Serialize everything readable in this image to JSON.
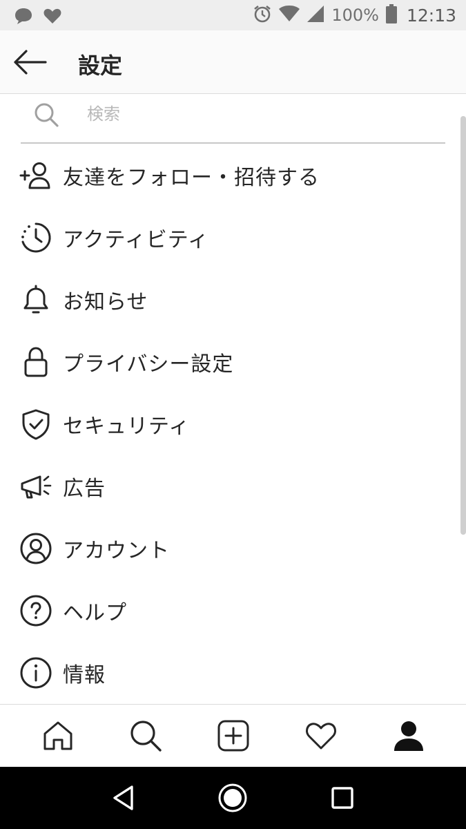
{
  "status_bar": {
    "battery": "100%",
    "time": "12:13",
    "icons": [
      "chat-bubble-icon",
      "heart-icon",
      "alarm-icon",
      "wifi-icon",
      "signal-icon",
      "battery-icon"
    ]
  },
  "header": {
    "title": "設定",
    "back_icon": "back-arrow-icon"
  },
  "search": {
    "placeholder": "検索",
    "value": ""
  },
  "menu": {
    "items": [
      {
        "label": "友達をフォロー・招待する",
        "icon": "add-person-icon"
      },
      {
        "label": "アクティビティ",
        "icon": "activity-clock-icon"
      },
      {
        "label": "お知らせ",
        "icon": "bell-icon"
      },
      {
        "label": "プライバシー設定",
        "icon": "lock-icon"
      },
      {
        "label": "セキュリティ",
        "icon": "shield-check-icon"
      },
      {
        "label": "広告",
        "icon": "megaphone-icon"
      },
      {
        "label": "アカウント",
        "icon": "account-icon"
      },
      {
        "label": "ヘルプ",
        "icon": "help-icon"
      },
      {
        "label": "情報",
        "icon": "info-icon"
      }
    ]
  },
  "bottom_nav": [
    "home-icon",
    "search-icon",
    "add-post-icon",
    "activity-heart-icon",
    "profile-icon"
  ],
  "system_nav": [
    "back-triangle-icon",
    "home-circle-icon",
    "recents-square-icon"
  ],
  "colors": {
    "text": "#262626",
    "divider": "#dbdbdb",
    "placeholder": "#b8b8b8",
    "status_bar_bg": "#eeeeee"
  }
}
